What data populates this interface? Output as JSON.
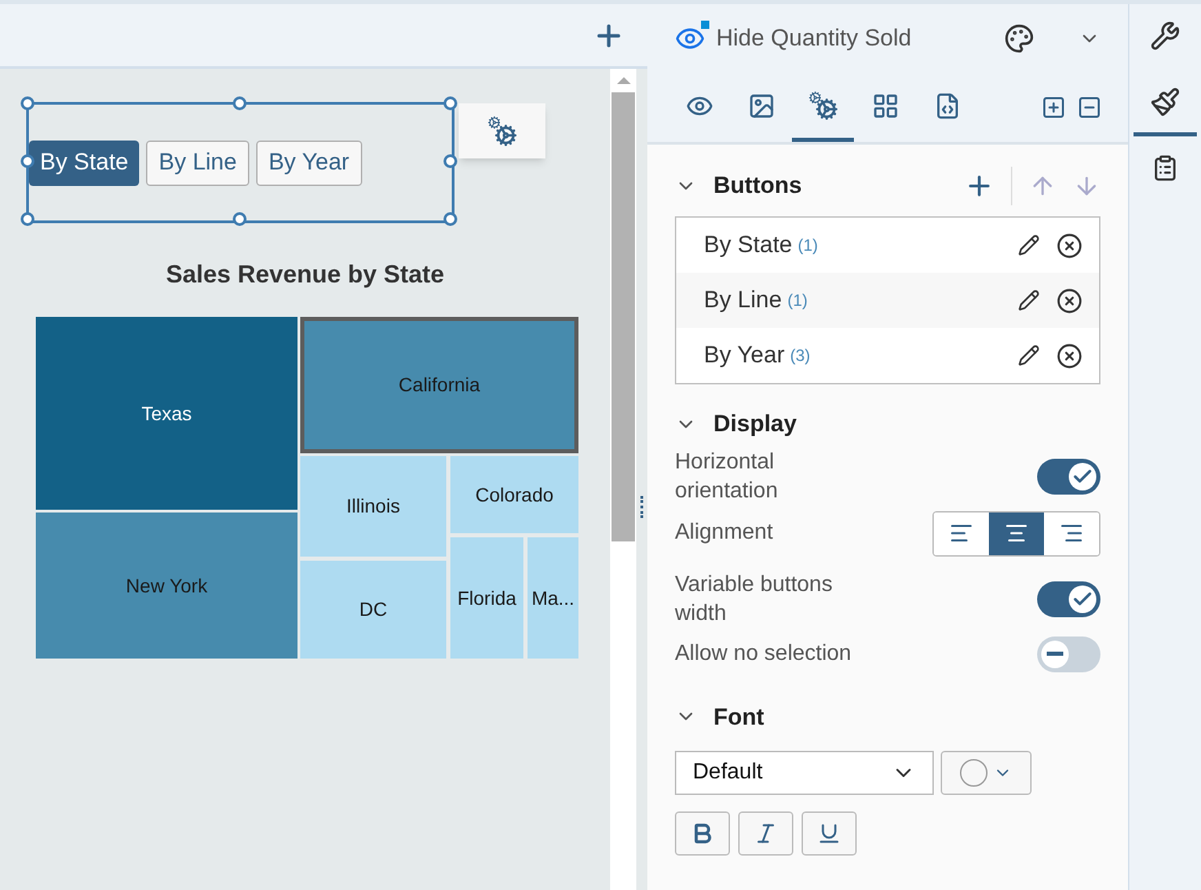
{
  "canvas": {
    "segmented_buttons": [
      {
        "label": "By State",
        "selected": true
      },
      {
        "label": "By Line",
        "selected": false
      },
      {
        "label": "By Year",
        "selected": false
      }
    ],
    "chart": {
      "title": "Sales Revenue by State",
      "tiles": [
        {
          "label": "Texas",
          "color": "#136187",
          "selected": false
        },
        {
          "label": "New York",
          "color": "#478bad",
          "selected": false
        },
        {
          "label": "California",
          "color": "#478bad",
          "selected": true
        },
        {
          "label": "Illinois",
          "color": "#aedbf1",
          "selected": false
        },
        {
          "label": "DC",
          "color": "#aedbf1",
          "selected": false
        },
        {
          "label": "Colorado",
          "color": "#aedbf1",
          "selected": false
        },
        {
          "label": "Florida",
          "color": "#aedbf1",
          "selected": false
        },
        {
          "label": "Ma...",
          "color": "#aedbf1",
          "selected": false
        }
      ]
    }
  },
  "panel": {
    "title": "Hide Quantity Sold",
    "tabs": [
      {
        "kind": "eye",
        "selected": false
      },
      {
        "kind": "image",
        "selected": false
      },
      {
        "kind": "gears",
        "selected": true
      },
      {
        "kind": "layout",
        "selected": false
      },
      {
        "kind": "code",
        "selected": false
      }
    ],
    "sections": {
      "buttons": {
        "title": "Buttons",
        "expanded": true,
        "items": [
          {
            "label": "By State",
            "count": "(1)"
          },
          {
            "label": "By Line",
            "count": "(1)"
          },
          {
            "label": "By Year",
            "count": "(3)"
          }
        ]
      },
      "display": {
        "title": "Display",
        "expanded": true,
        "horizontal_orientation": {
          "label": "Horizontal orientation",
          "on": true
        },
        "alignment": {
          "label": "Alignment",
          "options": [
            {
              "kind": "left",
              "selected": false
            },
            {
              "kind": "center",
              "selected": true
            },
            {
              "kind": "right",
              "selected": false
            }
          ]
        },
        "variable_width": {
          "label": "Variable buttons width",
          "on": true
        },
        "allow_no_selection": {
          "label": "Allow no selection",
          "on": false
        }
      },
      "font": {
        "title": "Font",
        "expanded": true,
        "family": "Default",
        "bold": false,
        "italic": false,
        "underline": false
      }
    }
  },
  "rail": [
    {
      "kind": "tools",
      "selected": false
    },
    {
      "kind": "brush",
      "selected": true
    },
    {
      "kind": "clipboard",
      "selected": false
    }
  ]
}
